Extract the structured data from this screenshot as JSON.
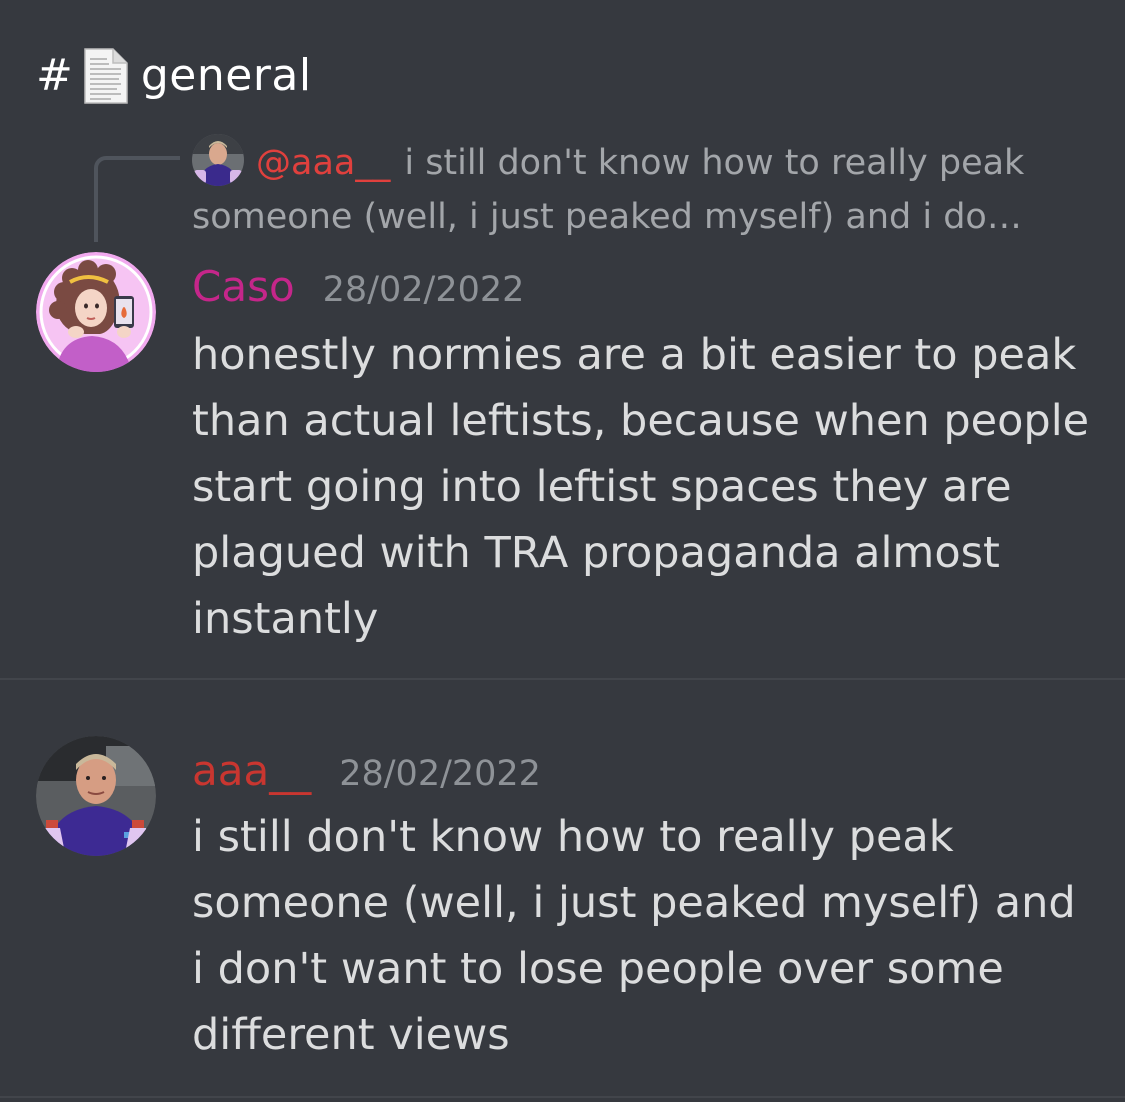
{
  "channel": {
    "hash": "#",
    "name": "general",
    "icon": "document-icon"
  },
  "reply_preview": {
    "mention": "@aaa__",
    "text": "i still don't know how to really peak someone (well, i just peaked myself) and i do…"
  },
  "messages": [
    {
      "author": "Caso",
      "author_color": "#c5268a",
      "timestamp": "28/02/2022",
      "text": "honestly normies are a bit easier to peak than actual leftists, because when people start going into leftist spaces they are plagued with TRA propaganda almost instantly"
    },
    {
      "author": "aaa__",
      "author_color": "#c93630",
      "timestamp": "28/02/2022",
      "text": "i still don't know how to really peak someone (well, i just peaked myself) and i don't want to lose people over some different views"
    }
  ],
  "colors": {
    "background": "#36393f",
    "mention": "#e0403d",
    "connector": "#4f545c"
  }
}
